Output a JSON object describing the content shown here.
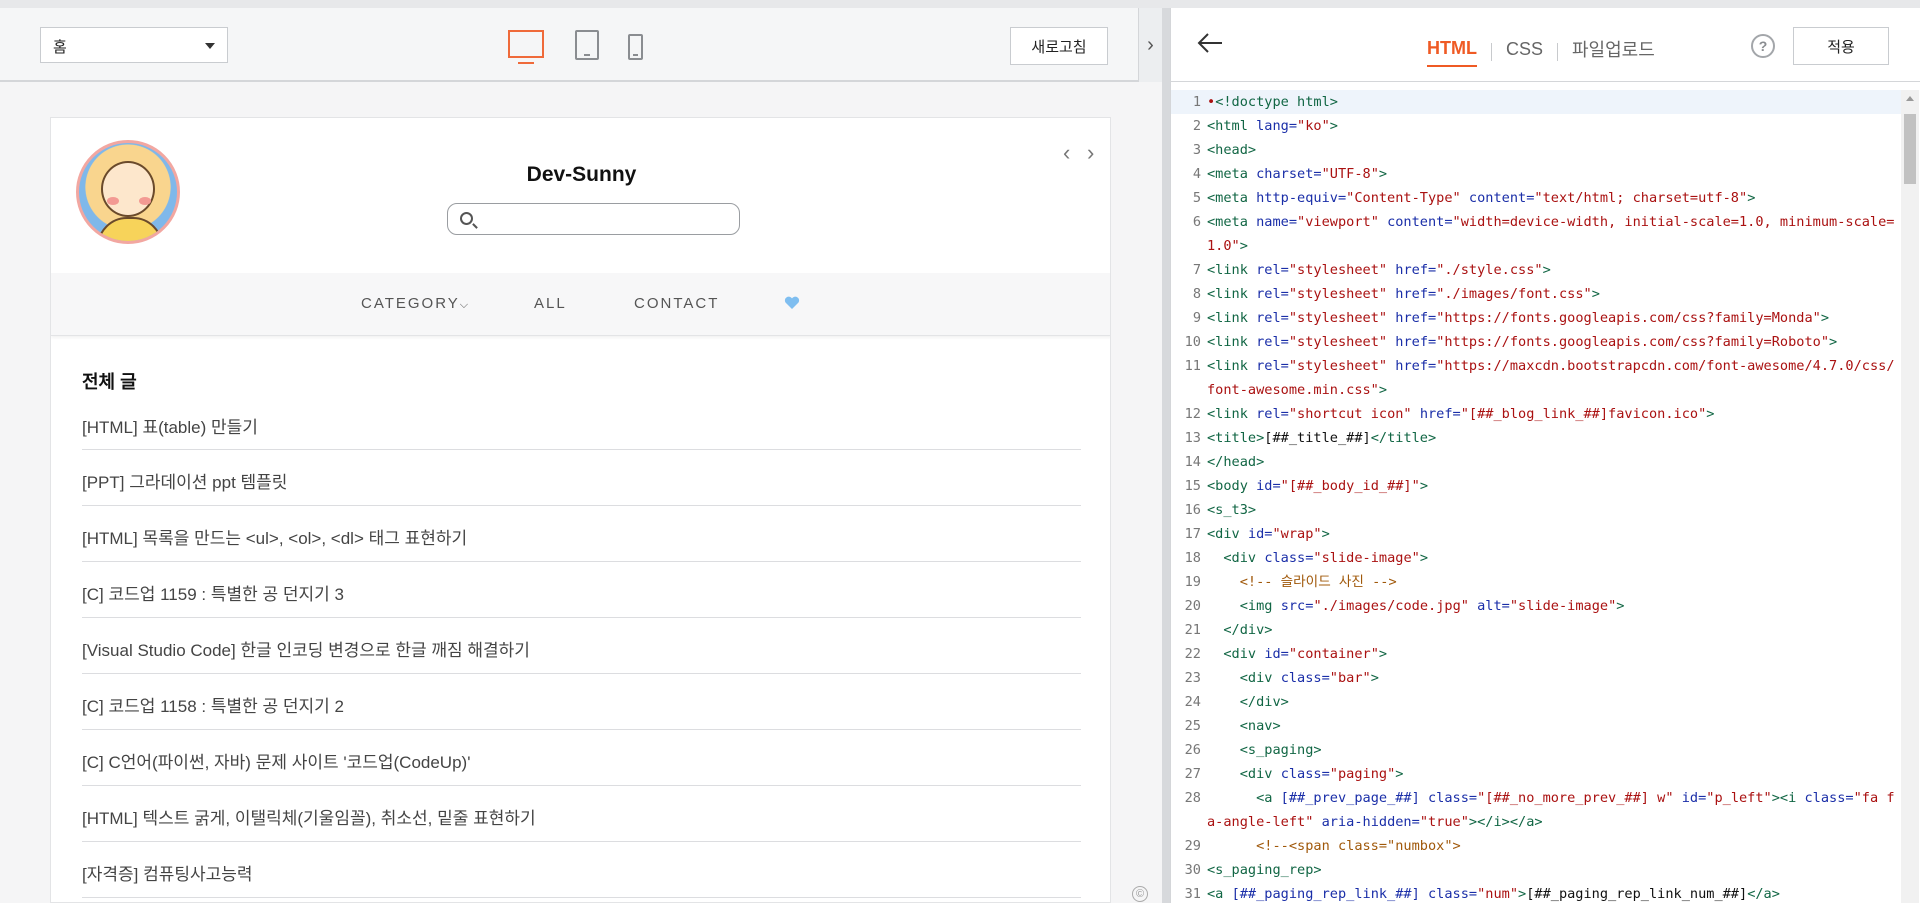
{
  "preview_toolbar": {
    "page_select_value": "홈",
    "refresh_label": "새로고침"
  },
  "blog": {
    "title": "Dev-Sunny",
    "nav": {
      "category": "CATEGORY",
      "all": "ALL",
      "contact": "CONTACT"
    },
    "list_title": "전체 글",
    "posts": [
      "[HTML] 표(table) 만들기",
      "[PPT] 그라데이션 ppt 템플릿",
      "[HTML] 목록을 만드는 <ul>, <ol>, <dl> 태그 표현하기",
      "[C] 코드업 1159 : 특별한 공 던지기 3",
      "[Visual Studio Code] 한글 인코딩 변경으로 한글 깨짐 해결하기",
      "[C] 코드업 1158 : 특별한 공 던지기 2",
      "[C] C언어(파이썬, 자바) 문제 사이트 '코드업(CodeUp)'",
      "[HTML] 텍스트 굵게, 이탤릭체(기울임꼴), 취소선, 밑줄 표현하기",
      "[자격증] 컴퓨팅사고능력"
    ]
  },
  "editor": {
    "tabs": [
      "HTML",
      "CSS",
      "파일업로드"
    ],
    "active_tab": "HTML",
    "help_label": "?",
    "apply_label": "적용",
    "code_lines": [
      {
        "n": "1",
        "html": "<span class=\"s\">•</span><span class=\"t\">&lt;!doctype html&gt;</span>"
      },
      {
        "n": "2",
        "html": "<span class=\"t\">&lt;html</span> <span class=\"a\">lang=</span><span class=\"s\">\"ko\"</span><span class=\"t\">&gt;</span>"
      },
      {
        "n": "3",
        "html": "<span class=\"t\">&lt;head&gt;</span>"
      },
      {
        "n": "4",
        "html": "<span class=\"t\">&lt;meta</span> <span class=\"a\">charset=</span><span class=\"s\">\"UTF-8\"</span><span class=\"t\">&gt;</span>"
      },
      {
        "n": "5",
        "html": "<span class=\"t\">&lt;meta</span> <span class=\"a\">http-equiv=</span><span class=\"s\">\"Content-Type\"</span> <span class=\"a\">content=</span><span class=\"s\">\"text/html; charset=utf-8\"</span><span class=\"t\">&gt;</span>"
      },
      {
        "n": "6",
        "html": "<span class=\"t\">&lt;meta</span> <span class=\"a\">name=</span><span class=\"s\">\"viewport\"</span> <span class=\"a\">content=</span><span class=\"s\">\"width=device-width, initial-scale=1.0, minimum-scale=1.0\"</span><span class=\"t\">&gt;</span>"
      },
      {
        "n": "7",
        "html": "<span class=\"t\">&lt;link</span> <span class=\"a\">rel=</span><span class=\"s\">\"stylesheet\"</span> <span class=\"a\">href=</span><span class=\"s\">\"./style.css\"</span><span class=\"t\">&gt;</span>"
      },
      {
        "n": "8",
        "html": "<span class=\"t\">&lt;link</span> <span class=\"a\">rel=</span><span class=\"s\">\"stylesheet\"</span> <span class=\"a\">href=</span><span class=\"s\">\"./images/font.css\"</span><span class=\"t\">&gt;</span>"
      },
      {
        "n": "9",
        "html": "<span class=\"t\">&lt;link</span> <span class=\"a\">rel=</span><span class=\"s\">\"stylesheet\"</span> <span class=\"a\">href=</span><span class=\"s\">\"https://fonts.googleapis.com/css?family=Monda\"</span><span class=\"t\">&gt;</span>"
      },
      {
        "n": "10",
        "html": "<span class=\"t\">&lt;link</span> <span class=\"a\">rel=</span><span class=\"s\">\"stylesheet\"</span> <span class=\"a\">href=</span><span class=\"s\">\"https://fonts.googleapis.com/css?family=Roboto\"</span><span class=\"t\">&gt;</span>"
      },
      {
        "n": "11",
        "html": "<span class=\"t\">&lt;link</span> <span class=\"a\">rel=</span><span class=\"s\">\"stylesheet\"</span> <span class=\"a\">href=</span><span class=\"s\">\"https://maxcdn.bootstrapcdn.com/font-awesome/4.7.0/css/font-awesome.min.css\"</span><span class=\"t\">&gt;</span>"
      },
      {
        "n": "12",
        "html": "<span class=\"t\">&lt;link</span> <span class=\"a\">rel=</span><span class=\"s\">\"shortcut icon\"</span> <span class=\"a\">href=</span><span class=\"s\">\"[##_blog_link_##]favicon.ico\"</span><span class=\"t\">&gt;</span>"
      },
      {
        "n": "13",
        "html": "<span class=\"t\">&lt;title&gt;</span><span class=\"p\">[##_title_##]</span><span class=\"t\">&lt;/title&gt;</span>"
      },
      {
        "n": "14",
        "html": "<span class=\"t\">&lt;/head&gt;</span>"
      },
      {
        "n": "15",
        "html": "<span class=\"t\">&lt;body</span> <span class=\"a\">id=</span><span class=\"s\">\"[##_body_id_##]\"</span><span class=\"t\">&gt;</span>"
      },
      {
        "n": "16",
        "html": "<span class=\"t\">&lt;s_t3&gt;</span>"
      },
      {
        "n": "17",
        "html": "<span class=\"t\">&lt;div</span> <span class=\"a\">id=</span><span class=\"s\">\"wrap\"</span><span class=\"t\">&gt;</span>"
      },
      {
        "n": "18",
        "html": "  <span class=\"t\">&lt;div</span> <span class=\"a\">class=</span><span class=\"s\">\"slide-image\"</span><span class=\"t\">&gt;</span>"
      },
      {
        "n": "19",
        "html": "    <span class=\"c\">&lt;!-- 슬라이드 사진 --&gt;</span>"
      },
      {
        "n": "20",
        "html": "    <span class=\"t\">&lt;img</span> <span class=\"a\">src=</span><span class=\"s\">\"./images/code.jpg\"</span> <span class=\"a\">alt=</span><span class=\"s\">\"slide-image\"</span><span class=\"t\">&gt;</span>"
      },
      {
        "n": "21",
        "html": "  <span class=\"t\">&lt;/div&gt;</span>"
      },
      {
        "n": "22",
        "html": "  <span class=\"t\">&lt;div</span> <span class=\"a\">id=</span><span class=\"s\">\"container\"</span><span class=\"t\">&gt;</span>"
      },
      {
        "n": "23",
        "html": "    <span class=\"t\">&lt;div</span> <span class=\"a\">class=</span><span class=\"s\">\"bar\"</span><span class=\"t\">&gt;</span>"
      },
      {
        "n": "24",
        "html": "    <span class=\"t\">&lt;/div&gt;</span>"
      },
      {
        "n": "25",
        "html": "    <span class=\"t\">&lt;nav&gt;</span>"
      },
      {
        "n": "26",
        "html": "    <span class=\"t\">&lt;s_paging&gt;</span>"
      },
      {
        "n": "27",
        "html": "    <span class=\"t\">&lt;div</span> <span class=\"a\">class=</span><span class=\"s\">\"paging\"</span><span class=\"t\">&gt;</span>"
      },
      {
        "n": "28",
        "html": "      <span class=\"t\">&lt;a</span> <span class=\"a\">[##_prev_page_##] class=</span><span class=\"s\">\"[##_no_more_prev_##] w\"</span> <span class=\"a\">id=</span><span class=\"s\">\"p_left\"</span><span class=\"t\">&gt;&lt;i</span> <span class=\"a\">class=</span><span class=\"s\">\"fa fa-angle-left\"</span> <span class=\"a\">aria-hidden=</span><span class=\"s\">\"true\"</span><span class=\"t\">&gt;&lt;/i&gt;&lt;/a&gt;</span>"
      },
      {
        "n": "29",
        "html": "      <span class=\"c\">&lt;!--&lt;span class=\"numbox\"&gt;</span>"
      },
      {
        "n": "30",
        "html": "<span class=\"t\">&lt;s_paging_rep&gt;</span>"
      },
      {
        "n": "31",
        "html": "<span class=\"t\">&lt;a</span> <span class=\"a\">[##_paging_rep_link_##] class=</span><span class=\"s\">\"num\"</span><span class=\"t\">&gt;</span><span class=\"p\">[##_paging_rep_link_num_##]</span><span class=\"t\">&lt;/a&gt;</span>"
      }
    ]
  }
}
